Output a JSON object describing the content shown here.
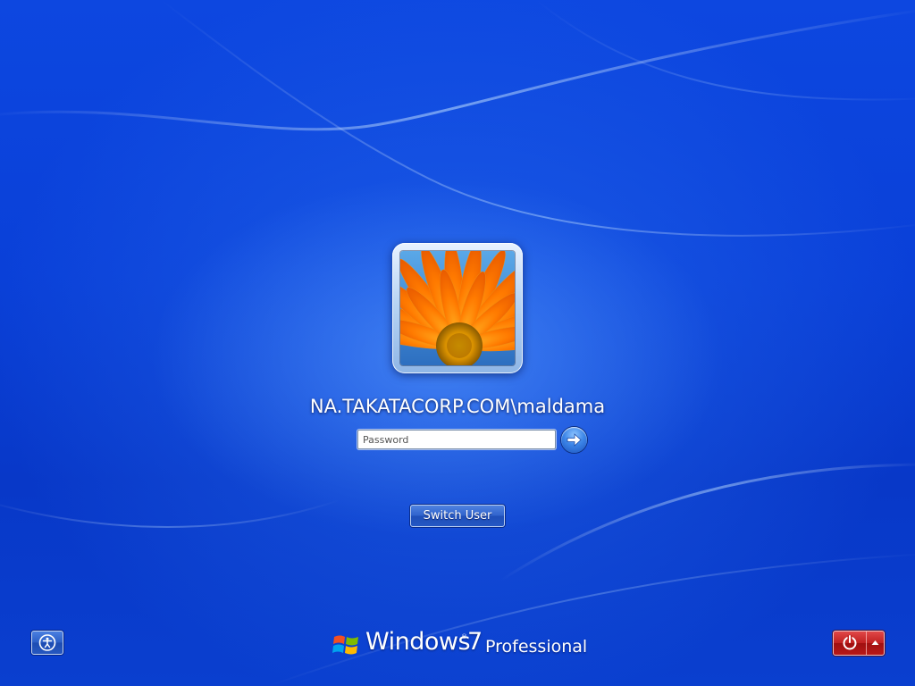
{
  "user": {
    "name": "NA.TAKATACORP.COM\\maldama",
    "tile_icon": "orange-gerbera-flower-picture"
  },
  "login": {
    "password_placeholder": "Password",
    "submit_icon": "arrow-right-icon"
  },
  "actions": {
    "switch_user_label": "Switch User"
  },
  "footer": {
    "ease_of_access_icon": "ease-of-access-icon",
    "brand_word": "Windows",
    "brand_version": "7",
    "brand_edition": "Professional",
    "brand_reg": "®",
    "shutdown_icon": "power-icon",
    "shutdown_menu_icon": "chevron-up-icon"
  },
  "colors": {
    "background": "#0a3fd0",
    "power_button": "#c02020",
    "tile_frame": "#b8d4f4"
  }
}
